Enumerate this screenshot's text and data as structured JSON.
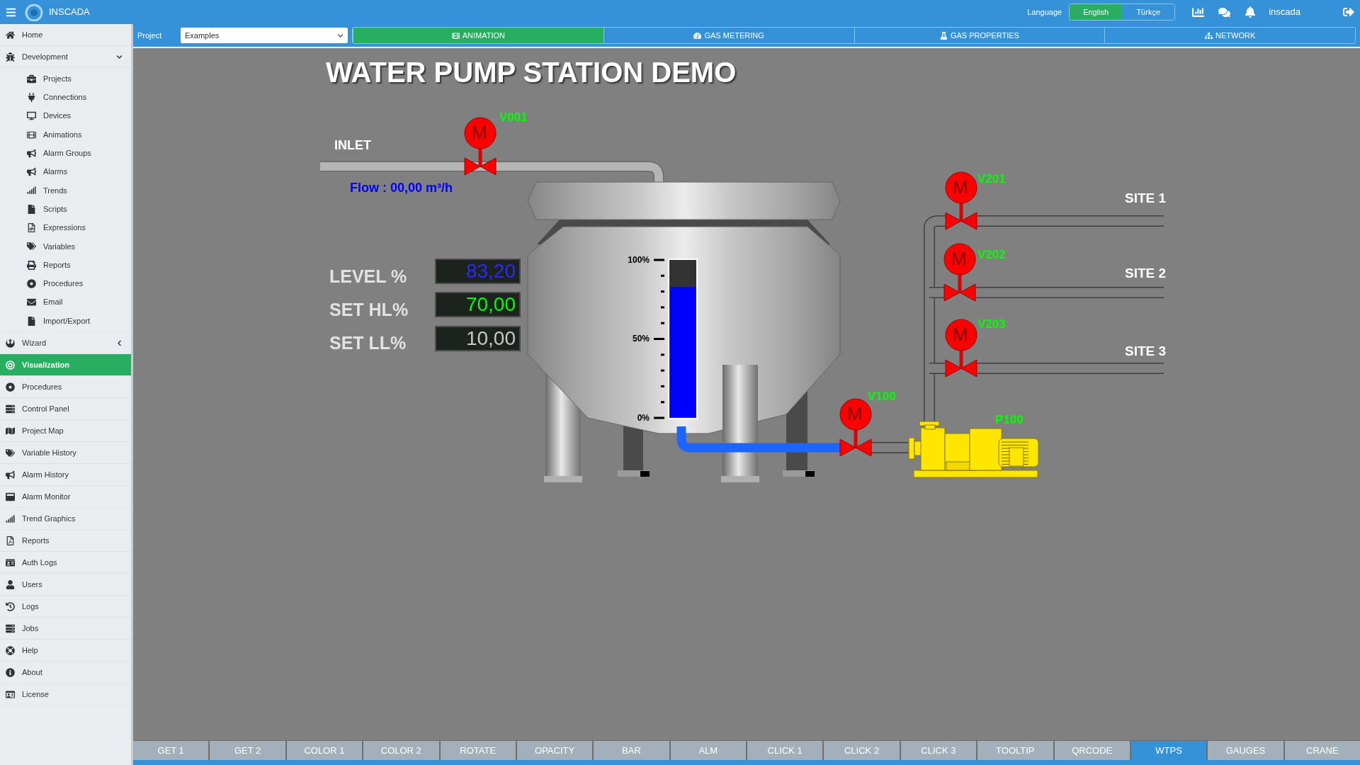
{
  "app": {
    "name": "INSCADA"
  },
  "top_bar": {
    "language_label": "Language",
    "languages": [
      {
        "label": "English",
        "selected": true
      },
      {
        "label": "Türkçe",
        "selected": false
      }
    ],
    "user": "inscada"
  },
  "sidebar": {
    "items": [
      {
        "label": "Home",
        "selected": false
      },
      {
        "label": "Development",
        "selected": false,
        "expanded": true,
        "children": [
          {
            "label": "Projects",
            "selected": false
          },
          {
            "label": "Connections",
            "selected": false
          },
          {
            "label": "Devices",
            "selected": false
          },
          {
            "label": "Animations",
            "selected": false
          },
          {
            "label": "Alarm Groups",
            "selected": false
          },
          {
            "label": "Alarms",
            "selected": false
          },
          {
            "label": "Trends",
            "selected": false
          },
          {
            "label": "Scripts",
            "selected": false
          },
          {
            "label": "Expressions",
            "selected": false
          },
          {
            "label": "Variables",
            "selected": false
          },
          {
            "label": "Reports",
            "selected": false
          },
          {
            "label": "Procedures",
            "selected": false
          },
          {
            "label": "Email",
            "selected": false
          },
          {
            "label": "Import/Export",
            "selected": false
          }
        ]
      },
      {
        "label": "Wizard",
        "selected": false,
        "expanded": false
      },
      {
        "label": "Visualization",
        "selected": true
      },
      {
        "label": "Procedures",
        "selected": false
      },
      {
        "label": "Control Panel",
        "selected": false
      },
      {
        "label": "Project Map",
        "selected": false
      },
      {
        "label": "Variable History",
        "selected": false
      },
      {
        "label": "Alarm History",
        "selected": false
      },
      {
        "label": "Alarm Monitor",
        "selected": false
      },
      {
        "label": "Trend Graphics",
        "selected": false
      },
      {
        "label": "Reports",
        "selected": false
      },
      {
        "label": "Auth Logs",
        "selected": false
      },
      {
        "label": "Users",
        "selected": false
      },
      {
        "label": "Logs",
        "selected": false
      },
      {
        "label": "Jobs",
        "selected": false
      },
      {
        "label": "Help",
        "selected": false
      },
      {
        "label": "About",
        "selected": false
      },
      {
        "label": "License",
        "selected": false
      }
    ]
  },
  "project_bar": {
    "label": "Project",
    "project_select": "Examples",
    "tabs": [
      {
        "label": "ANIMATION",
        "selected": true
      },
      {
        "label": "GAS METERING",
        "selected": false
      },
      {
        "label": "GAS PROPERTIES",
        "selected": false
      },
      {
        "label": "NETWORK",
        "selected": false
      }
    ]
  },
  "hmi": {
    "title": "WATER PUMP STATION DEMO",
    "inlet_label": "INLET",
    "flow_text": "Flow : 00,00 m³/h",
    "readouts": [
      {
        "label": "LEVEL %",
        "value": "83,20",
        "color": "#2a2aff"
      },
      {
        "label": "SET HL%",
        "value": "70,00",
        "color": "#00ff00"
      },
      {
        "label": "SET LL%",
        "value": "10,00",
        "color": "#c8c8c8"
      }
    ],
    "tank": {
      "level": 0.832,
      "scale": [
        "100%",
        "50%",
        "0%"
      ]
    },
    "valves": [
      {
        "tag": "V001",
        "actuator": "M"
      },
      {
        "tag": "V201",
        "actuator": "M"
      },
      {
        "tag": "V202",
        "actuator": "M"
      },
      {
        "tag": "V203",
        "actuator": "M"
      },
      {
        "tag": "V100",
        "actuator": "M"
      }
    ],
    "pump": {
      "tag": "P100"
    },
    "sites": [
      "SITE 1",
      "SITE 2",
      "SITE 3"
    ]
  },
  "bottom_tabs": [
    {
      "label": "GET 1",
      "selected": false
    },
    {
      "label": "GET 2",
      "selected": false
    },
    {
      "label": "COLOR 1",
      "selected": false
    },
    {
      "label": "COLOR 2",
      "selected": false
    },
    {
      "label": "ROTATE",
      "selected": false
    },
    {
      "label": "OPACITY",
      "selected": false
    },
    {
      "label": "BAR",
      "selected": false
    },
    {
      "label": "ALM",
      "selected": false
    },
    {
      "label": "CLICK 1",
      "selected": false
    },
    {
      "label": "CLICK 2",
      "selected": false
    },
    {
      "label": "CLICK 3",
      "selected": false
    },
    {
      "label": "TOOLTIP",
      "selected": false
    },
    {
      "label": "QRCODE",
      "selected": false
    },
    {
      "label": "WTPS",
      "selected": true
    },
    {
      "label": "GAUGES",
      "selected": false
    },
    {
      "label": "CRANE",
      "selected": false
    }
  ]
}
